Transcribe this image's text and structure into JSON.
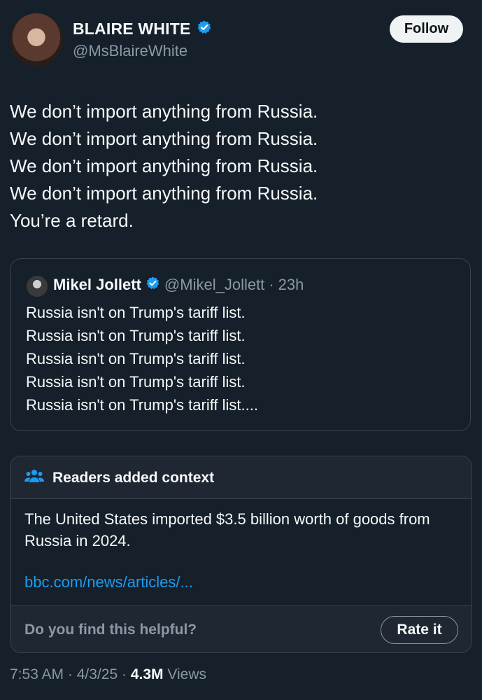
{
  "author": {
    "name": "BLAIRE WHITE",
    "handle": "@MsBlaireWhite",
    "verified": true
  },
  "follow_label": "Follow",
  "tweet": {
    "lines": [
      "We don’t import anything from Russia.",
      "We don’t import anything from Russia.",
      "We don’t import anything from Russia.",
      "We don’t import anything from Russia.",
      "You’re a retard."
    ]
  },
  "quoted": {
    "name": "Mikel Jollett",
    "handle": "@Mikel_Jollett",
    "separator": "·",
    "time": "23h",
    "lines": [
      "Russia isn't on Trump's tariff list.",
      "Russia isn't on Trump's tariff list.",
      "Russia isn't on Trump's tariff list.",
      "Russia isn't on Trump's tariff list.",
      "Russia isn't on Trump's tariff list...."
    ]
  },
  "community_note": {
    "title": "Readers added context",
    "body": "The United States imported $3.5 billion worth of goods from Russia in 2024.",
    "link": "bbc.com/news/articles/...",
    "helpful_question": "Do you find this helpful?",
    "rate_label": "Rate it"
  },
  "meta": {
    "time": "7:53 AM",
    "date": "4/3/25",
    "separator": "·",
    "views_count": "4.3M",
    "views_label": "Views"
  },
  "colors": {
    "background": "#15202b",
    "verified_blue": "#1d9bf0",
    "secondary_text": "#8b98a5"
  }
}
